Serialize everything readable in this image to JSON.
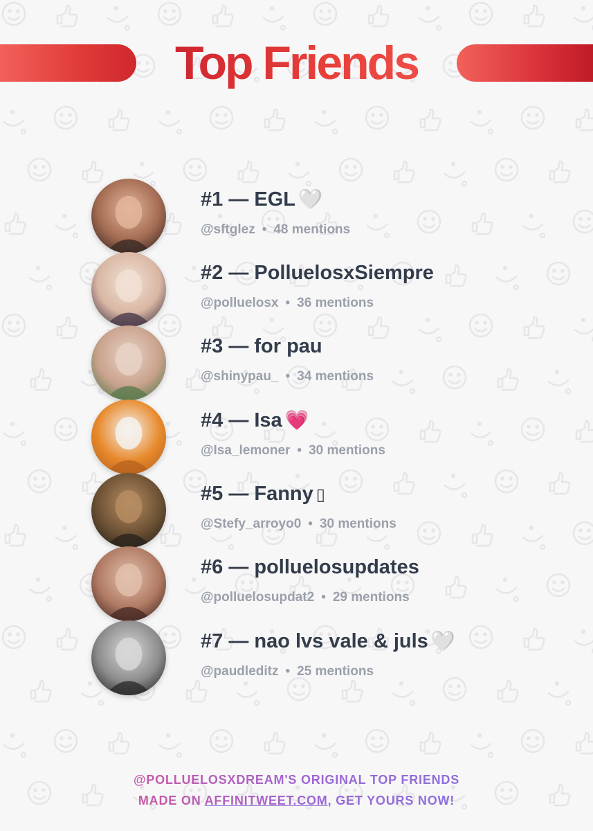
{
  "title": "Top Friends",
  "colors": {
    "accent": "#d92a33",
    "name_text": "#333c4a",
    "meta_text": "#9aa0aa",
    "footer_gradient_start": "#e84f80",
    "footer_gradient_end": "#7e75de"
  },
  "friends": [
    {
      "rank": "#1",
      "name": "EGL",
      "emoji": "🤍",
      "emoji_name": "white-heart-icon",
      "handle": "@sftglez",
      "mentions": "48 mentions"
    },
    {
      "rank": "#2",
      "name": "PolluelosxSiempre",
      "emoji": "",
      "emoji_name": "",
      "handle": "@polluelosx",
      "mentions": "36 mentions"
    },
    {
      "rank": "#3",
      "name": "for pau",
      "emoji": "",
      "emoji_name": "",
      "handle": "@shinypau_",
      "mentions": "34 mentions"
    },
    {
      "rank": "#4",
      "name": "Isa",
      "emoji": "💗",
      "emoji_name": "pink-heart-icon",
      "handle": "@Isa_lemoner",
      "mentions": "30 mentions"
    },
    {
      "rank": "#5",
      "name": "Fanny",
      "emoji": "▯",
      "emoji_name": "missing-glyph-icon",
      "handle": "@Stefy_arroyo0",
      "mentions": "30 mentions"
    },
    {
      "rank": "#6",
      "name": "polluelosupdates",
      "emoji": "",
      "emoji_name": "",
      "handle": "@polluelosupdat2",
      "mentions": "29 mentions"
    },
    {
      "rank": "#7",
      "name": "nao lvs vale & juls",
      "emoji": "🤍",
      "emoji_name": "white-heart-icon",
      "handle": "@paudleditz",
      "mentions": "25 mentions"
    }
  ],
  "footer": {
    "owner": "@POLLUELOSXDREAM",
    "line1_suffix": "'S ORIGINAL TOP FRIENDS",
    "line2_prefix": "MADE ON ",
    "site": "AFFINITWEET.COM",
    "line2_suffix": ", GET YOURS NOW!"
  }
}
